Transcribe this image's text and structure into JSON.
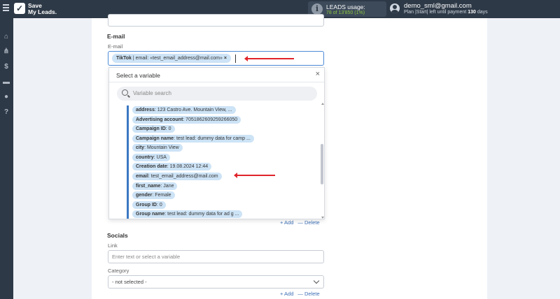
{
  "app": {
    "logo_mark": "✓",
    "logo_line1": "Save",
    "logo_line2": "My Leads."
  },
  "leads": {
    "title": "LEADS usage:",
    "count": "78 of 13'850 (1%)",
    "icon": "info-icon"
  },
  "user": {
    "email": "demo_sml@gmail.com",
    "plan_prefix": "Plan |Start| left until payment",
    "plan_days": "130",
    "plan_suffix": "days"
  },
  "sidebar": {
    "items": [
      {
        "icon": "home-icon",
        "glyph": "⌂"
      },
      {
        "icon": "sitemap-icon",
        "glyph": "⋔"
      },
      {
        "icon": "dollar-icon",
        "glyph": "$"
      },
      {
        "icon": "briefcase-icon",
        "glyph": "▬"
      },
      {
        "icon": "account-icon",
        "glyph": "●"
      },
      {
        "icon": "help-icon",
        "glyph": "?"
      }
    ]
  },
  "email_section": {
    "title": "E-mail",
    "field_label": "E-mail",
    "tag_source": "TikTok",
    "tag_text": " | email: «test_email_address@mail.com»",
    "tag_remove": "×"
  },
  "dropdown": {
    "title": "Select a variable",
    "close": "×",
    "search_placeholder": "Variable search",
    "items": [
      {
        "key": "address",
        "value": ": 123 Castro Ave. Mountain View, ..."
      },
      {
        "key": "Advertising account",
        "value": ": 7051862609259266050"
      },
      {
        "key": "Campaign ID",
        "value": ": 0"
      },
      {
        "key": "Campaign name",
        "value": ": test lead: dummy data for camp ..."
      },
      {
        "key": "city",
        "value": ": Mountain View"
      },
      {
        "key": "country",
        "value": ": USA"
      },
      {
        "key": "Creation date",
        "value": ": 19.08.2024 12:44"
      },
      {
        "key": "email",
        "value": ": test_email_address@mail.com"
      },
      {
        "key": "first_name",
        "value": ": Jane"
      },
      {
        "key": "gender",
        "value": ": Female"
      },
      {
        "key": "Group ID",
        "value": ": 0"
      },
      {
        "key": "Group name",
        "value": ": test lead: dummy data for ad g ..."
      }
    ]
  },
  "row_actions": {
    "add": "+ Add",
    "delete": "— Delete"
  },
  "socials": {
    "title": "Socials",
    "link_label": "Link",
    "link_placeholder": "Enter text or select a variable",
    "category_label": "Category",
    "category_value": "- not selected -"
  },
  "colors": {
    "topbar": "#2e3947",
    "accent": "#3b78c2",
    "tag_bg": "#cde3f6",
    "arrow": "#e0242b"
  }
}
